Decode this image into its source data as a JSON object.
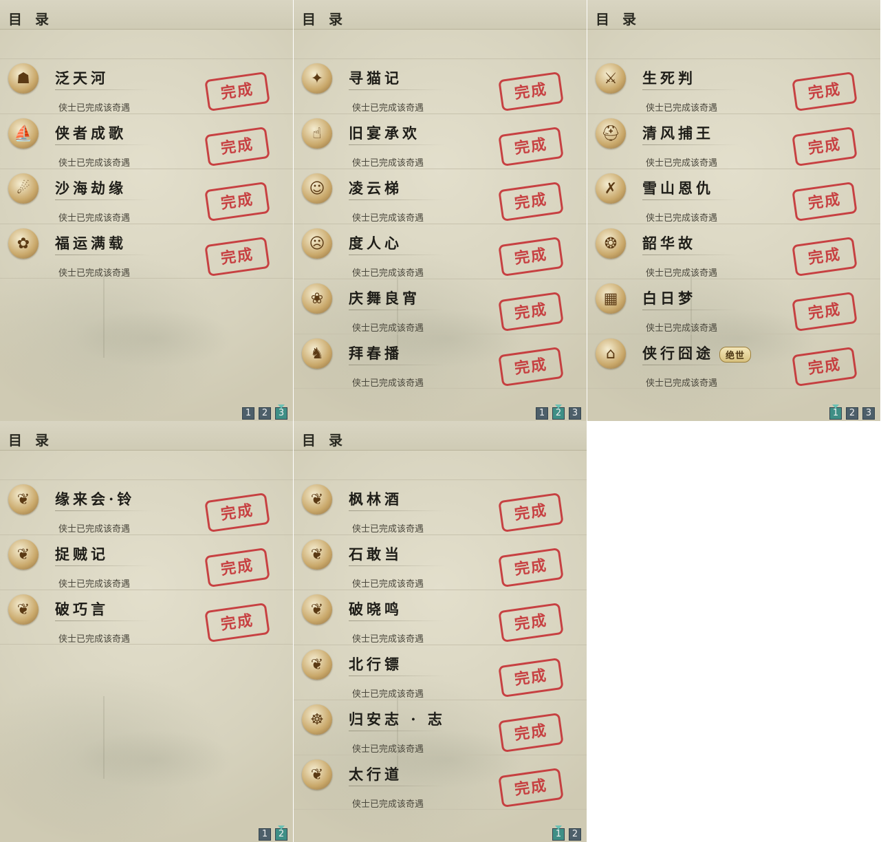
{
  "panels": [
    {
      "title": "目 录",
      "entries": [
        {
          "name": "泛天河",
          "status": "侠士已完成该奇遇",
          "stamp": "完成",
          "icon": "mask-icon"
        },
        {
          "name": "侠者成歌",
          "status": "侠士已完成该奇遇",
          "stamp": "完成",
          "icon": "boat-icon"
        },
        {
          "name": "沙海劫缘",
          "status": "侠士已完成该奇遇",
          "stamp": "完成",
          "icon": "tornado-icon"
        },
        {
          "name": "福运满载",
          "status": "侠士已完成该奇遇",
          "stamp": "完成",
          "icon": "fox-icon"
        }
      ],
      "pages": [
        "1",
        "2",
        "3"
      ],
      "active_page": 2
    },
    {
      "title": "目 录",
      "entries": [
        {
          "name": "寻猫记",
          "status": "侠士已完成该奇遇",
          "stamp": "完成",
          "icon": "raccoon-icon"
        },
        {
          "name": "旧宴承欢",
          "status": "侠士已完成该奇遇",
          "stamp": "完成",
          "icon": "thumbs-up-icon"
        },
        {
          "name": "凌云梯",
          "status": "侠士已完成该奇遇",
          "stamp": "完成",
          "icon": "monkey-icon"
        },
        {
          "name": "度人心",
          "status": "侠士已完成该奇遇",
          "stamp": "完成",
          "icon": "ghost-mask-icon"
        },
        {
          "name": "庆舞良宵",
          "status": "侠士已完成该奇遇",
          "stamp": "完成",
          "icon": "lion-dance-icon"
        },
        {
          "name": "拜春播",
          "status": "侠士已完成该奇遇",
          "stamp": "完成",
          "icon": "deer-icon"
        }
      ],
      "pages": [
        "1",
        "2",
        "3"
      ],
      "active_page": 1
    },
    {
      "title": "目 录",
      "entries": [
        {
          "name": "生死判",
          "status": "侠士已完成该奇遇",
          "stamp": "完成",
          "icon": "blade-icon"
        },
        {
          "name": "清风捕王",
          "status": "侠士已完成该奇遇",
          "stamp": "完成",
          "icon": "helmet-icon"
        },
        {
          "name": "雪山恩仇",
          "status": "侠士已完成该奇遇",
          "stamp": "完成",
          "icon": "swords-icon"
        },
        {
          "name": "韶华故",
          "status": "侠士已完成该奇遇",
          "stamp": "完成",
          "icon": "jade-icon"
        },
        {
          "name": "白日梦",
          "status": "侠士已完成该奇遇",
          "stamp": "完成",
          "icon": "bed-icon"
        },
        {
          "name": "侠行囧途",
          "status": "侠士已完成该奇遇",
          "stamp": "完成",
          "icon": "pavilion-icon",
          "badge": "绝世"
        }
      ],
      "pages": [
        "1",
        "2",
        "3"
      ],
      "active_page": 0
    },
    {
      "title": "目 录",
      "entries": [
        {
          "name": "缘来会·铃",
          "status": "侠士已完成该奇遇",
          "stamp": "完成",
          "icon": "cat-icon"
        },
        {
          "name": "捉贼记",
          "status": "侠士已完成该奇遇",
          "stamp": "完成",
          "icon": "cat-icon"
        },
        {
          "name": "破巧言",
          "status": "侠士已完成该奇遇",
          "stamp": "完成",
          "icon": "cat-icon"
        }
      ],
      "pages": [
        "1",
        "2"
      ],
      "active_page": 1
    },
    {
      "title": "目 录",
      "entries": [
        {
          "name": "枫林酒",
          "status": "侠士已完成该奇遇",
          "stamp": "完成",
          "icon": "cat-icon"
        },
        {
          "name": "石敢当",
          "status": "侠士已完成该奇遇",
          "stamp": "完成",
          "icon": "cat-icon"
        },
        {
          "name": "破晓鸣",
          "status": "侠士已完成该奇遇",
          "stamp": "完成",
          "icon": "cat-icon"
        },
        {
          "name": "北行镖",
          "status": "侠士已完成该奇遇",
          "stamp": "完成",
          "icon": "cat-icon"
        },
        {
          "name": "归安志 · 志",
          "status": "侠士已完成该奇遇",
          "stamp": "完成",
          "icon": "buddha-icon"
        },
        {
          "name": "太行道",
          "status": "侠士已完成该奇遇",
          "stamp": "完成",
          "icon": "cat-icon"
        }
      ],
      "pages": [
        "1",
        "2"
      ],
      "active_page": 0
    }
  ],
  "icon_glyphs": {
    "mask-icon": "☗",
    "boat-icon": "⛵",
    "tornado-icon": "☄",
    "fox-icon": "✿",
    "raccoon-icon": "✦",
    "thumbs-up-icon": "☝",
    "monkey-icon": "☺",
    "ghost-mask-icon": "☹",
    "lion-dance-icon": "❀",
    "deer-icon": "♞",
    "blade-icon": "⚔",
    "helmet-icon": "⛑",
    "swords-icon": "✗",
    "jade-icon": "❂",
    "bed-icon": "▦",
    "pavilion-icon": "⌂",
    "cat-icon": "❦",
    "buddha-icon": "☸"
  },
  "colors": {
    "stamp": "#c4272c",
    "pager": "#4d5f6a",
    "pager_active": "#3f8f86"
  }
}
